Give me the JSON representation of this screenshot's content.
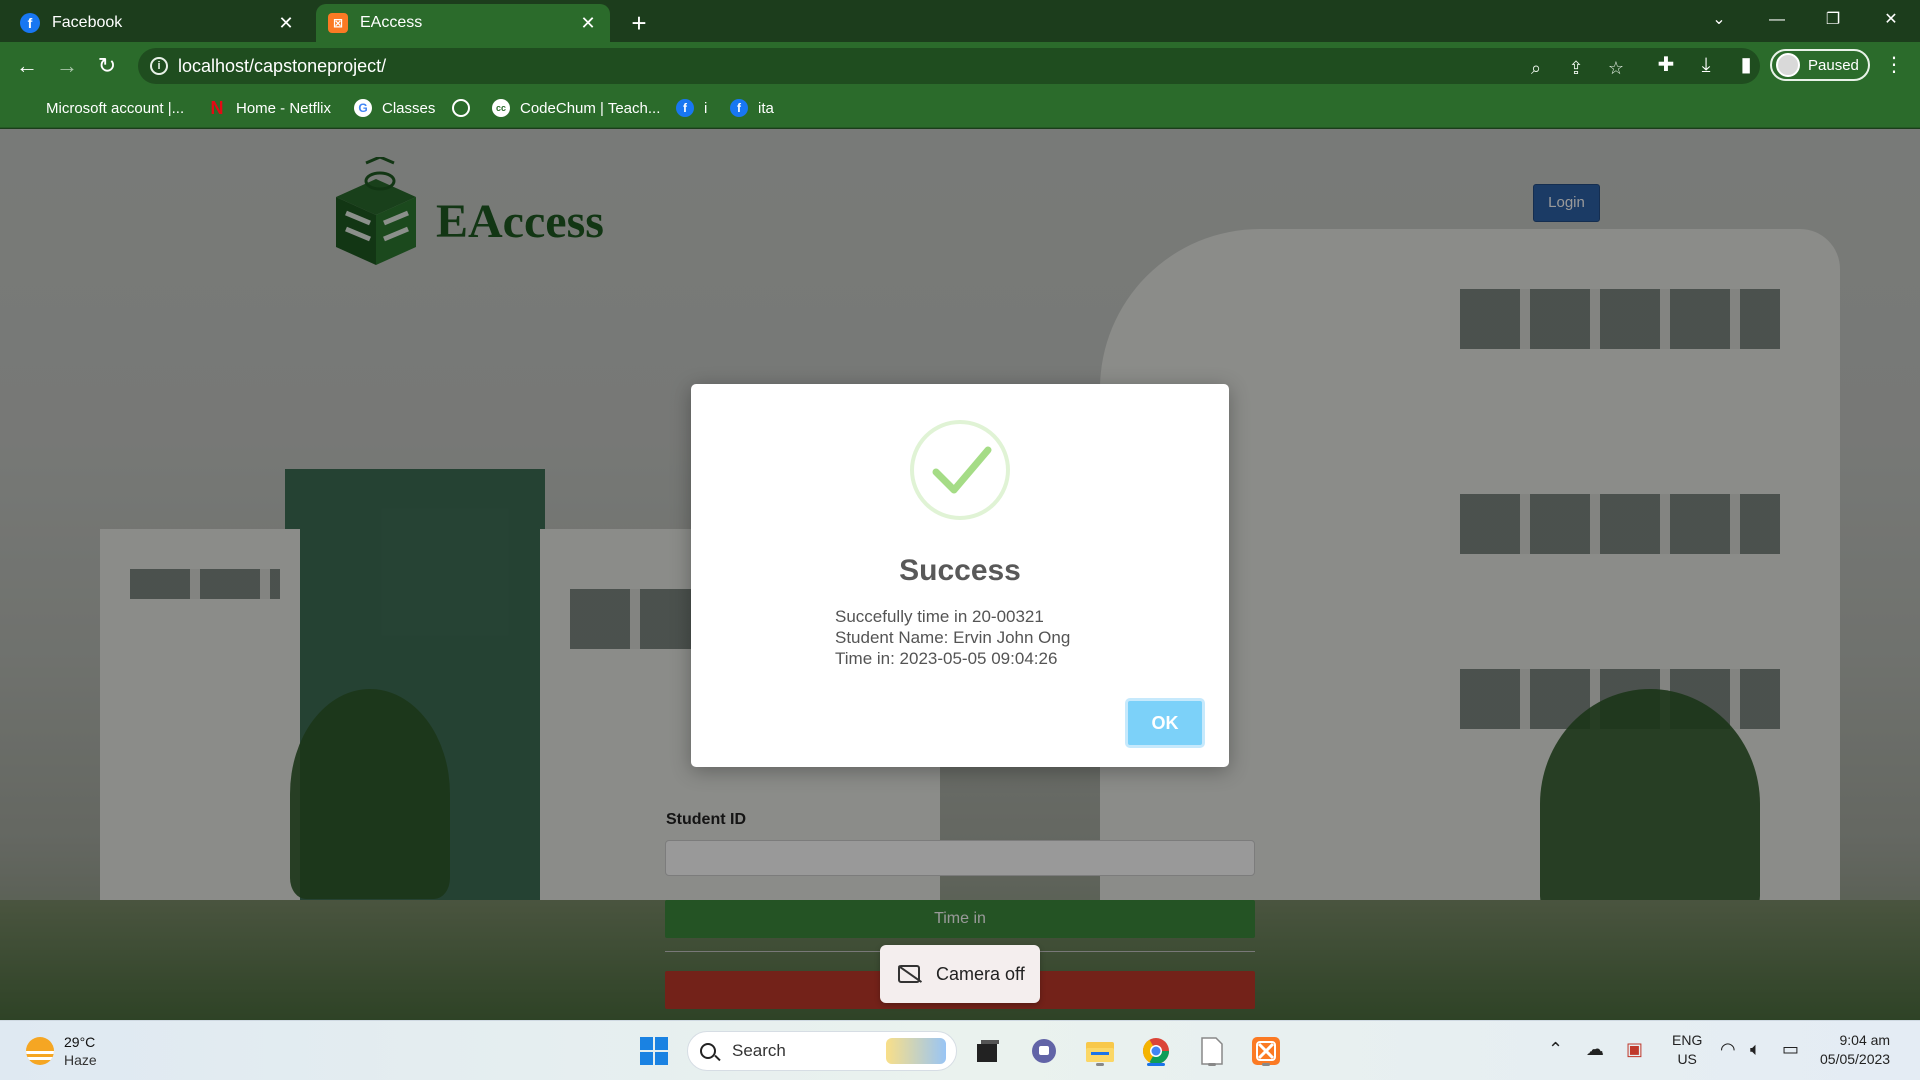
{
  "browser": {
    "tabs": [
      {
        "title": "Facebook",
        "icon": "facebook-icon",
        "active": false
      },
      {
        "title": "EAccess",
        "icon": "xampp-icon",
        "active": true
      }
    ],
    "url": "localhost/capstoneproject/",
    "profile_label": "Paused",
    "bookmarks": [
      {
        "label": "Microsoft account |...",
        "icon": "microsoft-icon"
      },
      {
        "label": "Home - Netflix",
        "icon": "netflix-icon"
      },
      {
        "label": "Classes",
        "icon": "google-icon"
      },
      {
        "label": "",
        "icon": "globe-icon"
      },
      {
        "label": "CodeChum | Teach...",
        "icon": "codechum-icon"
      },
      {
        "label": "i",
        "icon": "facebook-icon"
      },
      {
        "label": "ita",
        "icon": "facebook-icon"
      }
    ]
  },
  "page": {
    "brand_name": "EAccess",
    "login_label": "Login",
    "student_id_label": "Student ID",
    "time_in_label": "Time in",
    "camera_status": "Camera off"
  },
  "modal": {
    "title": "Success",
    "lines": [
      "Succefully time in 20-00321",
      "Student Name: Ervin John Ong",
      "Time in: 2023-05-05 09:04:26"
    ],
    "ok_label": "OK"
  },
  "taskbar": {
    "weather_temp": "29°C",
    "weather_condition": "Haze",
    "search_placeholder": "Search",
    "language": "ENG",
    "region": "US",
    "time": "9:04 am",
    "date": "05/05/2023"
  },
  "colors": {
    "chrome_green": "#2b6b2b",
    "brand_green": "#1f5a22",
    "login_blue": "#2e63a8",
    "time_in_green": "#3c8a3c",
    "danger_red": "#c0392b",
    "ok_blue": "#7cd1f9",
    "success_check": "#a5dc86"
  }
}
